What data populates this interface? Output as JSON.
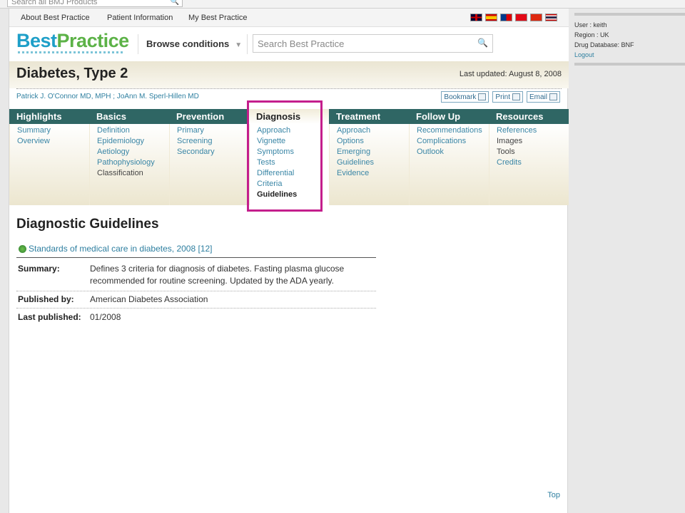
{
  "top": {
    "search_placeholder": "Search all BMJ Products"
  },
  "utility_nav": {
    "about": "About Best Practice",
    "patient": "Patient Information",
    "my": "My Best Practice"
  },
  "brand": {
    "logo_part1": "Best",
    "logo_part2": "Practice",
    "browse_label": "Browse conditions",
    "search_placeholder": "Search Best Practice"
  },
  "page": {
    "title": "Diabetes, Type 2",
    "last_updated": "Last updated: August 8, 2008",
    "authors": "Patrick J. O'Connor MD, MPH ; JoAnn M. Sperl-Hillen MD"
  },
  "actions": {
    "bookmark": "Bookmark",
    "print": "Print",
    "email": "Email"
  },
  "nav": {
    "highlights": {
      "label": "Highlights",
      "items": [
        "Summary",
        "Overview"
      ]
    },
    "basics": {
      "label": "Basics",
      "items": [
        "Definition",
        "Epidemiology",
        "Aetiology",
        "Pathophysiology",
        "Classification"
      ]
    },
    "prevention": {
      "label": "Prevention",
      "items": [
        "Primary",
        "Screening",
        "Secondary"
      ]
    },
    "diagnosis": {
      "label": "Diagnosis",
      "items": [
        "Approach",
        "Vignette",
        "Symptoms",
        "Tests",
        "Differential",
        "Criteria",
        "Guidelines"
      ]
    },
    "treatment": {
      "label": "Treatment",
      "items": [
        "Approach",
        "Options",
        "Emerging",
        "Guidelines",
        "Evidence"
      ]
    },
    "followup": {
      "label": "Follow Up",
      "items": [
        "Recommendations",
        "Complications",
        "Outlook"
      ]
    },
    "resources": {
      "label": "Resources",
      "items": [
        "References",
        "Images",
        "Tools",
        "Credits"
      ]
    }
  },
  "content": {
    "heading": "Diagnostic Guidelines",
    "guideline_link": "Standards of medical care in diabetes, 2008 [12]",
    "summary_label": "Summary:",
    "summary_text": "Defines 3 criteria for diagnosis of diabetes. Fasting plasma glucose recommended for routine screening. Updated by the ADA yearly.",
    "published_by_label": "Published by:",
    "published_by_value": "American Diabetes Association",
    "last_published_label": "Last published:",
    "last_published_value": "01/2008",
    "top_link": "Top"
  },
  "user_panel": {
    "user": "User : keith",
    "region": "Region : UK",
    "drug_db": "Drug Database: BNF",
    "logout": "Logout"
  },
  "colors": {
    "nav_header": "#2f6664",
    "link": "#2e7fa0",
    "highlight_box": "#c41e8c",
    "title_bar": "#eae5d2"
  }
}
